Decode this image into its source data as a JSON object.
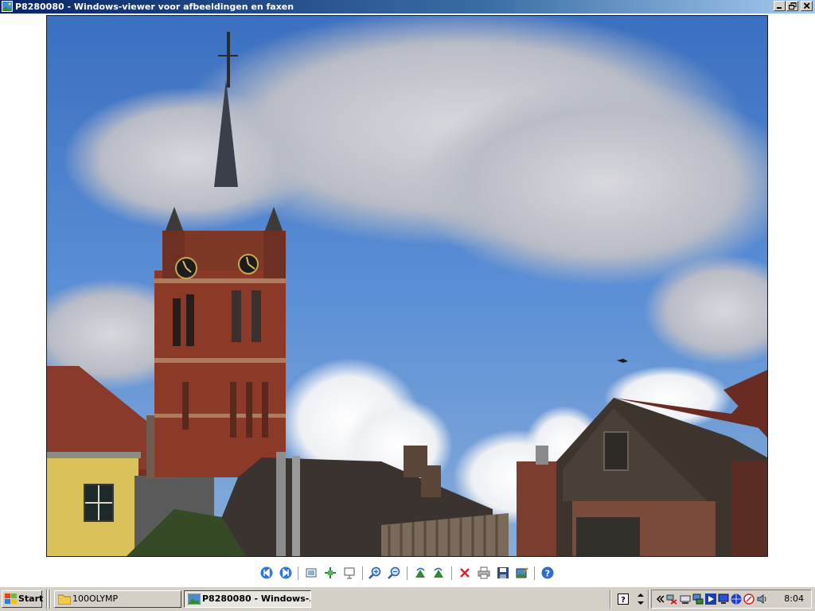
{
  "window": {
    "title": "P8280080 - Windows-viewer voor afbeeldingen en faxen",
    "controls": [
      "minimize-icon",
      "restore-icon",
      "close-icon"
    ]
  },
  "photo": {
    "subject": "church-tower-photo"
  },
  "toolbar": {
    "buttons": [
      "previous-image-icon",
      "next-image-icon",
      "best-fit-icon",
      "actual-size-icon",
      "slideshow-icon",
      "zoom-in-icon",
      "zoom-out-icon",
      "rotate-clockwise-icon",
      "rotate-counterclockwise-icon",
      "delete-icon",
      "print-icon",
      "save-icon",
      "edit-icon",
      "help-icon"
    ]
  },
  "taskbar": {
    "start_label": "Start",
    "tasks": [
      {
        "label": "100OLYMP",
        "icon": "folder-icon",
        "active": false
      },
      {
        "label": "P8280080 - Windows-...",
        "icon": "image-viewer-icon",
        "active": true
      }
    ],
    "clock": "8:04",
    "colors": {
      "taskbar": "#d4d0c8",
      "titlebar": "#0a246a"
    }
  }
}
